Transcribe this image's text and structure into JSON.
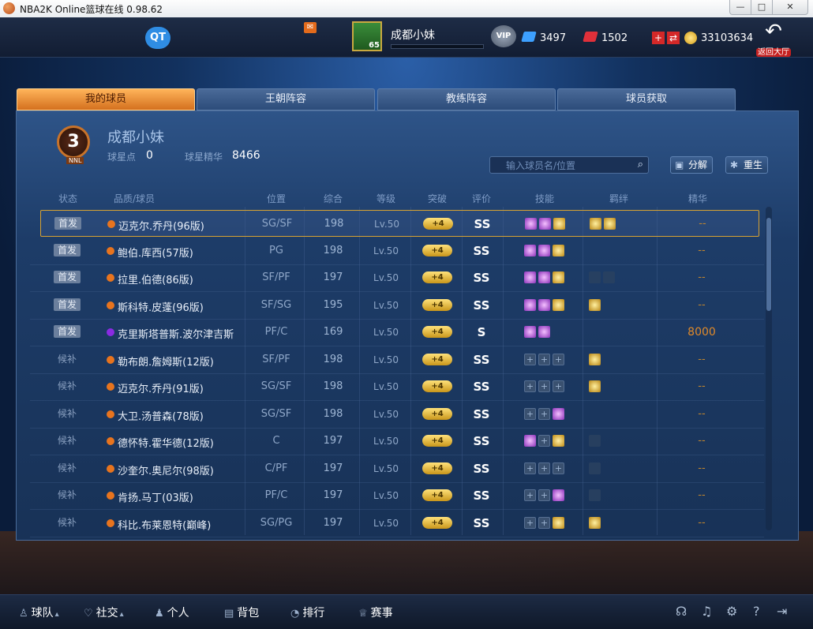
{
  "window": {
    "title": "NBA2K Online篮球在线 0.98.62",
    "min": "—",
    "max": "□",
    "close": "✕"
  },
  "topbar": {
    "qt_label": "QT",
    "player_name": "成都小妹",
    "player_level": "65",
    "vip_label": "VIP",
    "diamonds": "3497",
    "tickets": "1502",
    "gold": "33103634",
    "back_label": "返回大厅"
  },
  "tabs": [
    {
      "label": "我的球员",
      "active": true
    },
    {
      "label": "王朝阵容",
      "active": false
    },
    {
      "label": "教练阵容",
      "active": false
    },
    {
      "label": "球员获取",
      "active": false
    }
  ],
  "profile": {
    "rank_number": "3",
    "rank_tag": "NNL",
    "name": "成都小妹",
    "star_points_label": "球星点",
    "star_points": "0",
    "essence_label": "球星精华",
    "essence": "8466"
  },
  "search": {
    "placeholder": "输入球员名/位置",
    "value": ""
  },
  "actions": {
    "decompose": "分解",
    "rebirth": "重生"
  },
  "table": {
    "headers": [
      "状态",
      "品质/球员",
      "位置",
      "综合",
      "等级",
      "突破",
      "评价",
      "技能",
      "羁绊",
      "精华"
    ],
    "rows": [
      {
        "status": "首发",
        "quality": "orange",
        "name": "迈克尔.乔丹(96版)",
        "pos": "SG/SF",
        "ovr": "198",
        "level": "Lv.50",
        "breakthrough": "+4",
        "grade": "SS",
        "skills": [
          "purple",
          "purple",
          "gold"
        ],
        "bonds": [
          "gold",
          "gold"
        ],
        "essence": "--",
        "selected": true
      },
      {
        "status": "首发",
        "quality": "orange",
        "name": "鲍伯.库西(57版)",
        "pos": "PG",
        "ovr": "198",
        "level": "Lv.50",
        "breakthrough": "+4",
        "grade": "SS",
        "skills": [
          "purple",
          "purple",
          "gold"
        ],
        "bonds": [],
        "essence": "--"
      },
      {
        "status": "首发",
        "quality": "orange",
        "name": "拉里.伯德(86版)",
        "pos": "SF/PF",
        "ovr": "197",
        "level": "Lv.50",
        "breakthrough": "+4",
        "grade": "SS",
        "skills": [
          "purple",
          "purple",
          "gold"
        ],
        "bonds": [
          "dim",
          "dim"
        ],
        "essence": "--"
      },
      {
        "status": "首发",
        "quality": "orange",
        "name": "斯科特.皮蓬(96版)",
        "pos": "SF/SG",
        "ovr": "195",
        "level": "Lv.50",
        "breakthrough": "+4",
        "grade": "SS",
        "skills": [
          "purple",
          "purple",
          "gold"
        ],
        "bonds": [
          "gold"
        ],
        "essence": "--"
      },
      {
        "status": "首发",
        "quality": "purple",
        "name": "克里斯塔普斯.波尔津吉斯",
        "pos": "PF/C",
        "ovr": "169",
        "level": "Lv.50",
        "breakthrough": "+4",
        "grade": "S",
        "skills": [
          "purple",
          "purple"
        ],
        "bonds": [],
        "essence": "8000"
      },
      {
        "status": "候补",
        "quality": "orange",
        "name": "勒布朗.詹姆斯(12版)",
        "pos": "SF/PF",
        "ovr": "198",
        "level": "Lv.50",
        "breakthrough": "+4",
        "grade": "SS",
        "skills": [
          "empty",
          "empty",
          "empty"
        ],
        "bonds": [
          "gold"
        ],
        "essence": "--"
      },
      {
        "status": "候补",
        "quality": "orange",
        "name": "迈克尔.乔丹(91版)",
        "pos": "SG/SF",
        "ovr": "198",
        "level": "Lv.50",
        "breakthrough": "+4",
        "grade": "SS",
        "skills": [
          "empty",
          "empty",
          "empty"
        ],
        "bonds": [
          "gold"
        ],
        "essence": "--"
      },
      {
        "status": "候补",
        "quality": "orange",
        "name": "大卫.汤普森(78版)",
        "pos": "SG/SF",
        "ovr": "198",
        "level": "Lv.50",
        "breakthrough": "+4",
        "grade": "SS",
        "skills": [
          "empty",
          "empty",
          "purple"
        ],
        "bonds": [],
        "essence": "--"
      },
      {
        "status": "候补",
        "quality": "orange",
        "name": "德怀特.霍华德(12版)",
        "pos": "C",
        "ovr": "197",
        "level": "Lv.50",
        "breakthrough": "+4",
        "grade": "SS",
        "skills": [
          "purple",
          "empty",
          "gold"
        ],
        "bonds": [
          "dim"
        ],
        "essence": "--"
      },
      {
        "status": "候补",
        "quality": "orange",
        "name": "沙奎尔.奥尼尔(98版)",
        "pos": "C/PF",
        "ovr": "197",
        "level": "Lv.50",
        "breakthrough": "+4",
        "grade": "SS",
        "skills": [
          "empty",
          "empty",
          "empty"
        ],
        "bonds": [
          "dim"
        ],
        "essence": "--"
      },
      {
        "status": "候补",
        "quality": "orange",
        "name": "肯扬.马丁(03版)",
        "pos": "PF/C",
        "ovr": "197",
        "level": "Lv.50",
        "breakthrough": "+4",
        "grade": "SS",
        "skills": [
          "empty",
          "empty",
          "purple"
        ],
        "bonds": [
          "dim"
        ],
        "essence": "--"
      },
      {
        "status": "候补",
        "quality": "orange",
        "name": "科比.布莱恩特(巅峰)",
        "pos": "SG/PG",
        "ovr": "197",
        "level": "Lv.50",
        "breakthrough": "+4",
        "grade": "SS",
        "skills": [
          "empty",
          "empty",
          "gold"
        ],
        "bonds": [
          "gold"
        ],
        "essence": "--"
      }
    ]
  },
  "bottom_nav": [
    {
      "label": "球队",
      "icon": "team-icon",
      "glyph": "♙",
      "arrow": "▴"
    },
    {
      "label": "社交",
      "icon": "social-icon",
      "glyph": "♡",
      "arrow": "▴"
    },
    {
      "label": "个人",
      "icon": "person-icon",
      "glyph": "♟",
      "arrow": ""
    },
    {
      "label": "背包",
      "icon": "bag-icon",
      "glyph": "▤",
      "arrow": ""
    },
    {
      "label": "排行",
      "icon": "ranking-icon",
      "glyph": "◔",
      "arrow": ""
    },
    {
      "label": "赛事",
      "icon": "trophy-icon",
      "glyph": "♕",
      "arrow": ""
    }
  ],
  "colors": {
    "orange_quality": "#e8741e",
    "purple_quality": "#8a2be2",
    "accent_tab": "#e58a2a",
    "selection_border": "#d7a233"
  }
}
